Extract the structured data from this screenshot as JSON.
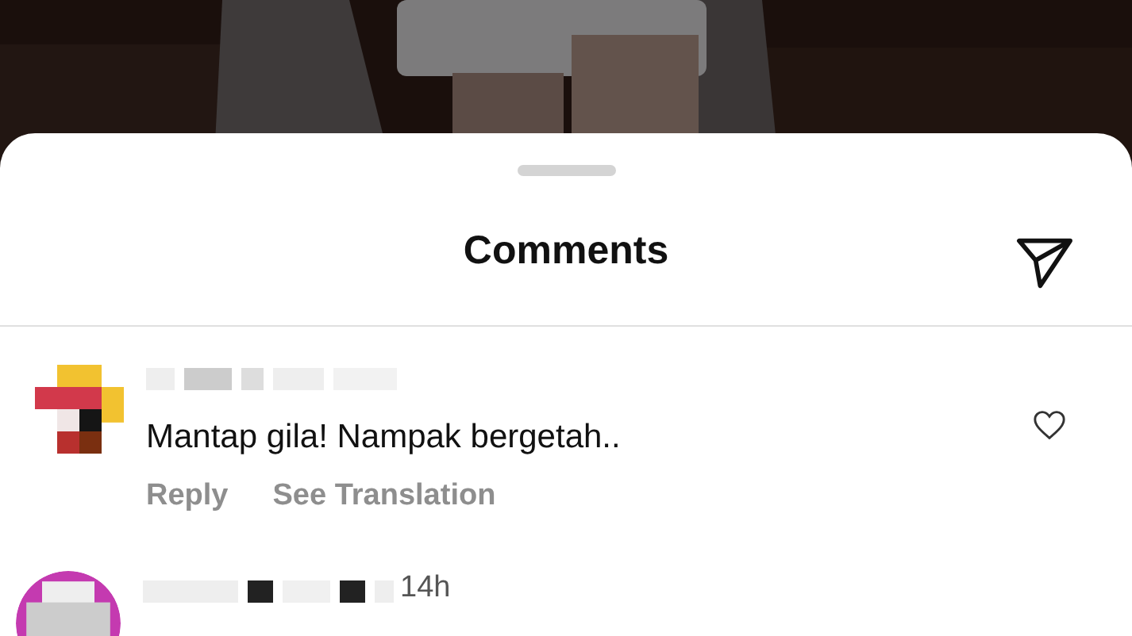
{
  "sheet": {
    "title": "Comments"
  },
  "comments": [
    {
      "text": "Mantap gila! Nampak bergetah..",
      "actions": [
        "Reply",
        "See Translation"
      ],
      "liked": false
    },
    {
      "time": "14h"
    }
  ]
}
